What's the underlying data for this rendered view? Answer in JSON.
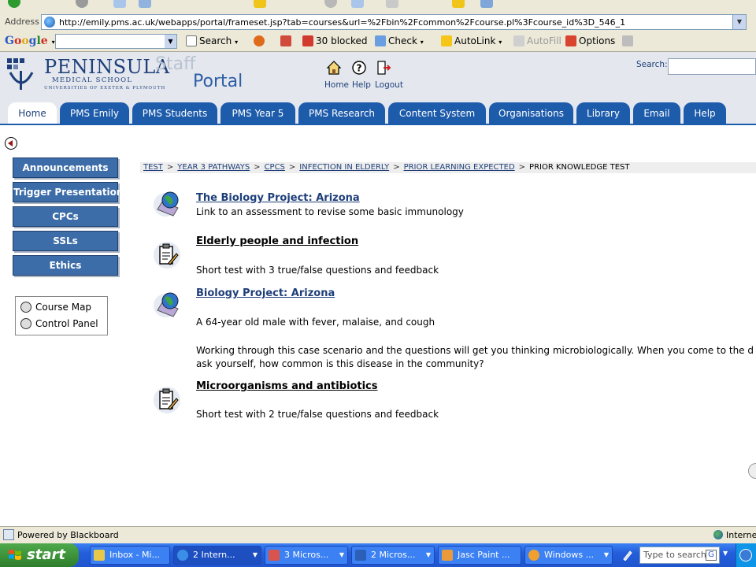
{
  "browser": {
    "address_label": "Address",
    "url": "http://emily.pms.ac.uk/webapps/portal/frameset.jsp?tab=courses&url=%2Fbin%2Fcommon%2Fcourse.pl%3Fcourse_id%3D_546_1",
    "google_toolbar": {
      "logo": [
        "G",
        "o",
        "o",
        "g",
        "l",
        "e"
      ],
      "search_label": "Search",
      "blocked_label": "30 blocked",
      "check_label": "Check",
      "autolink_label": "AutoLink",
      "autofill_label": "AutoFill",
      "options_label": "Options"
    }
  },
  "portal": {
    "logo_name": "PENINSULA",
    "logo_sub": "MEDICAL SCHOOL",
    "logo_sub2": "UNIVERSITIES OF EXETER & PLYMOUTH",
    "staff_label": "Staff",
    "portal_label": "Portal",
    "nav": {
      "home": "Home",
      "help": "Help",
      "logout": "Logout"
    },
    "search_label": "Search:",
    "tabs": [
      {
        "label": "Home",
        "active": true
      },
      {
        "label": "PMS Emily"
      },
      {
        "label": "PMS Students"
      },
      {
        "label": "PMS Year 5"
      },
      {
        "label": "PMS Research"
      },
      {
        "label": "Content System"
      },
      {
        "label": "Organisations"
      },
      {
        "label": "Library"
      },
      {
        "label": "Email"
      },
      {
        "label": "Help"
      }
    ]
  },
  "sidebar": {
    "buttons": [
      "Announcements",
      "Trigger Presentations",
      "CPCs",
      "SSLs",
      "Ethics"
    ],
    "tools": [
      "Course Map",
      "Control Panel"
    ]
  },
  "breadcrumb": {
    "links": [
      "TEST",
      "YEAR 3 PATHWAYS",
      "CPCS",
      "INFECTION IN ELDERLY",
      "PRIOR LEARNING EXPECTED"
    ],
    "current": "PRIOR KNOWLEDGE TEST",
    "separator": ">"
  },
  "content": {
    "items": [
      {
        "title": "The Biology Project: Arizona",
        "type": "link",
        "lines": [
          "Link to an assessment to revise some basic immunology"
        ]
      },
      {
        "title": "Elderly people and infection",
        "type": "test",
        "lines": [
          "Short test with 3 true/false questions and feedback"
        ]
      },
      {
        "title": "Biology Project: Arizona",
        "type": "link",
        "lines": [
          "A 64-year old male with fever, malaise, and cough",
          "Working through this case scenario and the questions will get you thinking microbiologically.  When you come to the d",
          "ask yourself, how common is this disease in the community?"
        ]
      },
      {
        "title": "Microorganisms and antibiotics",
        "type": "test",
        "lines": [
          "Short test with 2 true/false questions and feedback"
        ]
      }
    ]
  },
  "status": {
    "text": "Powered by Blackboard",
    "zone": "Interne"
  },
  "taskbar": {
    "start_label": "start",
    "buttons": [
      {
        "label": "Inbox - Mi...",
        "color": "#e8c84a"
      },
      {
        "label": "2 Intern...",
        "color": "#3b8ee8",
        "pressed": true
      },
      {
        "label": "3 Micros...",
        "color": "#d9534f"
      },
      {
        "label": "2 Micros...",
        "color": "#2b5fb8"
      },
      {
        "label": "Jasc Paint ...",
        "color": "#e89a3c"
      },
      {
        "label": "Windows ...",
        "color": "#f0a030"
      }
    ],
    "search_placeholder": "Type to search"
  },
  "colors": {
    "tab_blue": "#1d5bab",
    "sidebar_blue": "#3c6da8",
    "link_blue": "#1f3f7a"
  }
}
